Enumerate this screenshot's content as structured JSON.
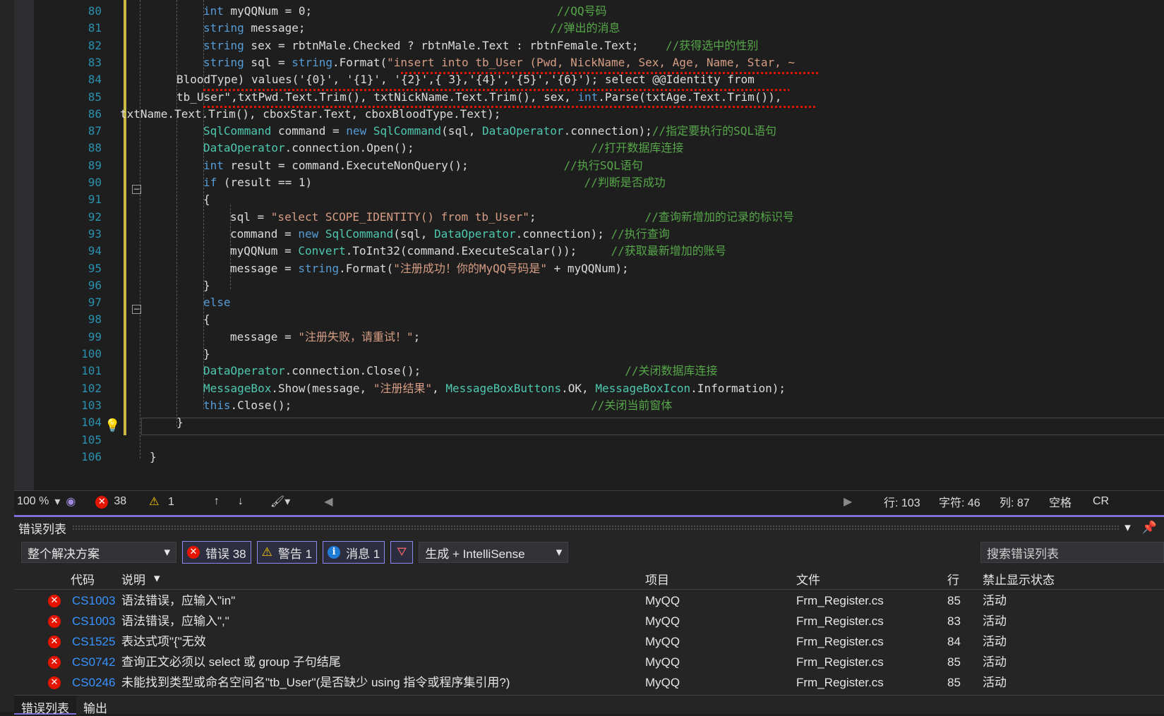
{
  "editor": {
    "lines": [
      {
        "n": "80",
        "indent": 3,
        "parts": [
          [
            "kw",
            "int"
          ],
          [
            "",
            "",
            " myQQNum = 0;"
          ],
          [
            "pad",
            ""
          ],
          [
            "cm",
            "//QQ号码"
          ]
        ]
      },
      {
        "n": "81",
        "indent": 3,
        "parts": [
          [
            "kw",
            "string"
          ],
          [
            "",
            "",
            " message;"
          ],
          [
            "pad",
            ""
          ],
          [
            "cm",
            "//弹出的消息"
          ]
        ]
      },
      {
        "n": "82",
        "indent": 3,
        "parts": [
          [
            "kw",
            "string"
          ],
          [
            "",
            "",
            " sex = rbtnMale.Checked ? rbtnMale.Text : rbtnFemale.Text;    "
          ],
          [
            "cm",
            "//获得选中的性别"
          ]
        ]
      },
      {
        "n": "83",
        "indent": 3,
        "parts": [
          [
            "kw",
            "string"
          ],
          [
            "",
            "",
            " sql = "
          ],
          [
            "kw",
            "string"
          ],
          [
            "",
            ".Format("
          ],
          [
            "st",
            "\"insert into tb_User (Pwd, NickName, Sex, Age, Name, Star, ~"
          ]
        ]
      },
      {
        "n": "84",
        "indent": 2,
        "parts": [
          [
            "",
            "BloodType) values('{0}', '{1}', '{2}',{ 3},'{4}','{5}','{6}'); select @@Identity from"
          ]
        ]
      },
      {
        "n": "85",
        "indent": 2,
        "parts": [
          [
            "",
            "tb_User\",txtPwd.Text.Trim(), txtNickName.Text.Trim(), sex, "
          ],
          [
            "kw",
            "int"
          ],
          [
            "",
            ".Parse(txtAge.Text.Trim()),"
          ]
        ]
      },
      {
        "n": "86",
        "indent": 0,
        "parts": [
          [
            "",
            "txtName.Text.Trim(), cboxStar.Text, cboxBloodType.Text);"
          ]
        ]
      },
      {
        "n": "87",
        "indent": 3,
        "parts": [
          [
            "ty",
            "SqlCommand"
          ],
          [
            "",
            " command = "
          ],
          [
            "kw",
            "new"
          ],
          [
            "",
            "",
            " "
          ],
          [
            "ty",
            "SqlCommand"
          ],
          [
            "",
            "(sql, "
          ],
          [
            "ty",
            "DataOperator"
          ],
          [
            "",
            ".connection);"
          ],
          [
            "cm",
            "//指定要执行的SQL语句"
          ]
        ]
      },
      {
        "n": "88",
        "indent": 3,
        "parts": [
          [
            "ty",
            "DataOperator"
          ],
          [
            "",
            ".connection.Open();                          "
          ],
          [
            "cm",
            "//打开数据库连接"
          ]
        ]
      },
      {
        "n": "89",
        "indent": 3,
        "parts": [
          [
            "kw",
            "int"
          ],
          [
            "",
            " result = command.ExecuteNonQuery();              "
          ],
          [
            "cm",
            "//执行SQL语句"
          ]
        ]
      },
      {
        "n": "90",
        "indent": 3,
        "parts": [
          [
            "kw",
            "if"
          ],
          [
            "",
            " (result == 1)                                        "
          ],
          [
            "cm",
            "//判断是否成功"
          ]
        ]
      },
      {
        "n": "91",
        "indent": 3,
        "parts": [
          [
            "",
            "{"
          ]
        ]
      },
      {
        "n": "92",
        "indent": 4,
        "parts": [
          [
            "",
            "sql = "
          ],
          [
            "st",
            "\"select SCOPE_IDENTITY() from tb_User\""
          ],
          [
            "",
            ";                "
          ],
          [
            "cm",
            "//查询新增加的记录的标识号"
          ]
        ]
      },
      {
        "n": "93",
        "indent": 4,
        "parts": [
          [
            "",
            "command = "
          ],
          [
            "kw",
            "new"
          ],
          [
            "",
            " "
          ],
          [
            "ty",
            "SqlCommand"
          ],
          [
            "",
            "(sql, "
          ],
          [
            "ty",
            "DataOperator"
          ],
          [
            "",
            ".connection); "
          ],
          [
            "cm",
            "//执行查询"
          ]
        ]
      },
      {
        "n": "94",
        "indent": 4,
        "parts": [
          [
            "",
            "myQQNum = "
          ],
          [
            "ty",
            "Convert"
          ],
          [
            "",
            ".ToInt32(command.ExecuteScalar());     "
          ],
          [
            "cm",
            "//获取最新增加的账号"
          ]
        ]
      },
      {
        "n": "95",
        "indent": 4,
        "parts": [
          [
            "",
            "message = "
          ],
          [
            "kw",
            "string"
          ],
          [
            "",
            ".Format("
          ],
          [
            "st",
            "\"注册成功！你的MyQQ号码是\""
          ],
          [
            "",
            " + myQQNum);"
          ]
        ]
      },
      {
        "n": "96",
        "indent": 3,
        "parts": [
          [
            "",
            "}"
          ]
        ]
      },
      {
        "n": "97",
        "indent": 3,
        "parts": [
          [
            "kw",
            "else"
          ]
        ]
      },
      {
        "n": "98",
        "indent": 3,
        "parts": [
          [
            "",
            "{"
          ]
        ]
      },
      {
        "n": "99",
        "indent": 4,
        "parts": [
          [
            "",
            "message = "
          ],
          [
            "st",
            "\"注册失败，请重试！\""
          ],
          [
            "",
            ";"
          ]
        ]
      },
      {
        "n": "100",
        "indent": 3,
        "parts": [
          [
            "",
            "}"
          ]
        ]
      },
      {
        "n": "101",
        "indent": 3,
        "parts": [
          [
            "ty",
            "DataOperator"
          ],
          [
            "",
            ".connection.Close();                              "
          ],
          [
            "cm",
            "//关闭数据库连接"
          ]
        ]
      },
      {
        "n": "102",
        "indent": 3,
        "parts": [
          [
            "ty",
            "MessageBox"
          ],
          [
            "",
            ".Show(message, "
          ],
          [
            "st",
            "\"注册结果\""
          ],
          [
            "",
            ", "
          ],
          [
            "ty",
            "MessageBoxButtons"
          ],
          [
            "",
            ".OK, "
          ],
          [
            "ty",
            "MessageBoxIcon"
          ],
          [
            "",
            ".Information);"
          ]
        ]
      },
      {
        "n": "103",
        "indent": 3,
        "parts": [
          [
            "kw",
            "this"
          ],
          [
            "",
            ".Close();                                            "
          ],
          [
            "cm",
            "//关闭当前窗体"
          ]
        ]
      },
      {
        "n": "104",
        "indent": 2,
        "parts": [
          [
            "",
            "}"
          ]
        ]
      },
      {
        "n": "105",
        "indent": 2,
        "parts": [
          [
            "",
            ""
          ]
        ]
      },
      {
        "n": "106",
        "indent": 1,
        "parts": [
          [
            "",
            "}"
          ]
        ]
      }
    ]
  },
  "status": {
    "zoom": "100 %",
    "errors": "38",
    "warnings": "1",
    "line": "行: 103",
    "char": "字符: 46",
    "col": "列: 87",
    "space": "空格",
    "crlf": "CR"
  },
  "panel": {
    "title": "错误列表",
    "scope": "整个解决方案",
    "errors_label": "错误 38",
    "warnings_label": "警告 1",
    "messages_label": "消息 1",
    "build_source": "生成 + IntelliSense",
    "search_placeholder": "搜索错误列表",
    "columns": {
      "code": "代码",
      "desc": "说明",
      "project": "项目",
      "file": "文件",
      "line": "行",
      "suppress": "禁止显示状态"
    },
    "rows": [
      {
        "code": "CS1003",
        "desc": "语法错误，应输入\"in\"",
        "project": "MyQQ",
        "file": "Frm_Register.cs",
        "line": "85",
        "state": "活动"
      },
      {
        "code": "CS1003",
        "desc": "语法错误，应输入\",\"",
        "project": "MyQQ",
        "file": "Frm_Register.cs",
        "line": "83",
        "state": "活动"
      },
      {
        "code": "CS1525",
        "desc": "表达式项\"{\"无效",
        "project": "MyQQ",
        "file": "Frm_Register.cs",
        "line": "84",
        "state": "活动"
      },
      {
        "code": "CS0742",
        "desc": "查询正文必须以 select 或 group 子句结尾",
        "project": "MyQQ",
        "file": "Frm_Register.cs",
        "line": "85",
        "state": "活动"
      },
      {
        "code": "CS0246",
        "desc": "未能找到类型或命名空间名\"tb_User\"(是否缺少 using 指令或程序集引用?)",
        "project": "MyQQ",
        "file": "Frm_Register.cs",
        "line": "85",
        "state": "活动"
      }
    ],
    "tab_errors": "错误列表",
    "tab_output": "输出"
  }
}
